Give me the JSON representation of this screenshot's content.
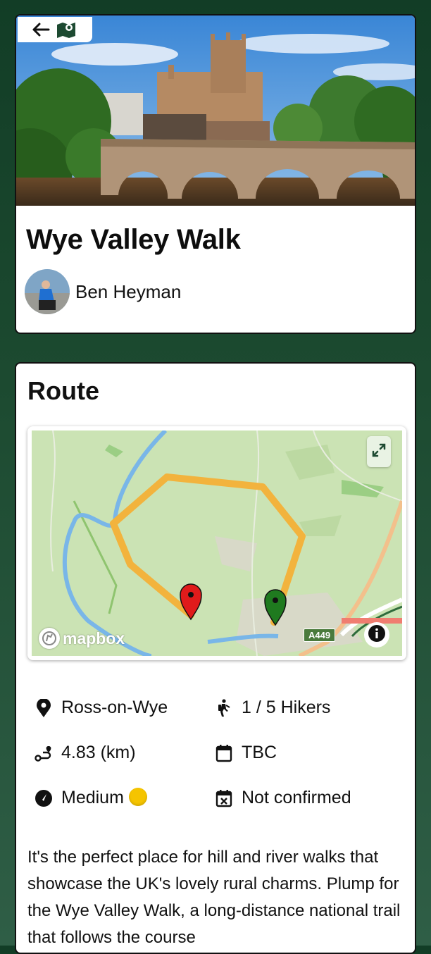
{
  "walk": {
    "title": "Wye Valley Walk",
    "author": "Ben Heyman"
  },
  "nav": {
    "back_icon": "arrow-left-icon",
    "map_icon": "map-icon"
  },
  "route": {
    "section_title": "Route",
    "map": {
      "attribution": "mapbox",
      "road_label": "A449",
      "expand_icon": "expand-icon",
      "info_icon": "info-icon"
    },
    "stats": {
      "location": "Ross-on-Wye",
      "hikers": "1 / 5 Hikers",
      "distance": "4.83 (km)",
      "date": "TBC",
      "difficulty": "Medium",
      "difficulty_dot_color": "#f5c400",
      "status": "Not confirmed"
    },
    "description": "It's the perfect place for hill and river walks that showcase the UK's lovely rural charms. Plump for the Wye Valley Walk, a long-distance national trail that follows the course"
  },
  "colors": {
    "background": "#1c4a30",
    "route_line": "#f2b33d",
    "start_pin": "#e01b1b",
    "end_pin": "#1f7a1f"
  }
}
